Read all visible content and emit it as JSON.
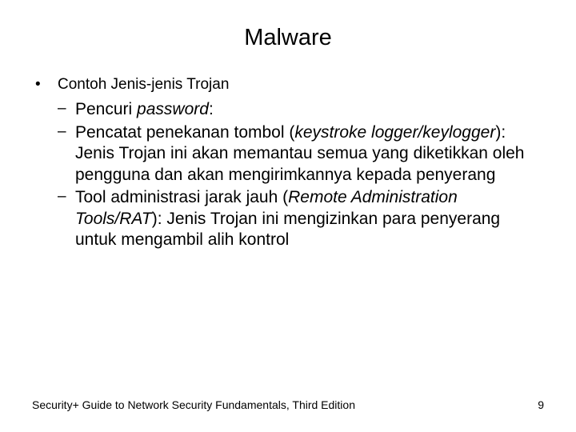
{
  "title": "Malware",
  "topic": {
    "bullet": "•",
    "text": "Contoh Jenis-jenis Trojan"
  },
  "items": {
    "item1": {
      "dash": "–",
      "prefix": "Pencuri ",
      "italic": "password",
      "suffix": ":"
    },
    "item2": {
      "dash": "–",
      "prefix": "Pencatat penekanan tombol (",
      "italic": "keystroke logger/keylogger",
      "suffix": "): Jenis Trojan ini akan memantau semua yang diketikkan oleh pengguna dan akan mengirimkannya kepada penyerang"
    },
    "item3": {
      "dash": "–",
      "prefix": "Tool administrasi jarak jauh (",
      "italic": "Remote Administration Tools/RAT",
      "suffix": "): Jenis Trojan ini mengizinkan para penyerang untuk mengambil alih kontrol"
    }
  },
  "footer": {
    "left": "Security+ Guide to Network Security Fundamentals, Third Edition",
    "right": "9"
  }
}
